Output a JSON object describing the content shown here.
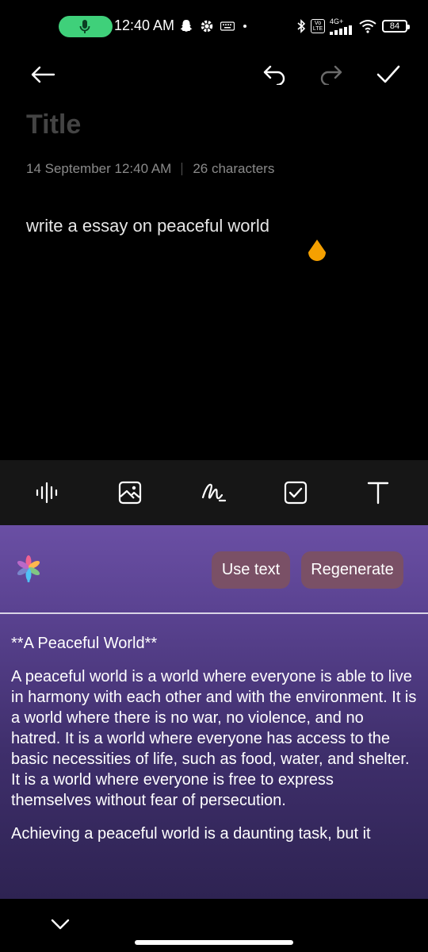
{
  "status_bar": {
    "time": "12:40 AM",
    "battery": "84",
    "network": "4G+",
    "volte": "Vo LTE",
    "icons": [
      "mic-icon",
      "snapchat-icon",
      "settings-icon",
      "keyboard-icon",
      "dot-icon",
      "bluetooth-icon",
      "signal-icon",
      "wifi-icon",
      "battery-icon"
    ]
  },
  "toolbar": {
    "icons": [
      "back-arrow-icon",
      "undo-icon",
      "redo-icon",
      "check-icon"
    ]
  },
  "note": {
    "title_placeholder": "Title",
    "date": "14 September 12:40 AM",
    "char_count": "26 characters",
    "body": "write a essay on peaceful world"
  },
  "format_bar": {
    "icons": [
      "audio-icon",
      "image-icon",
      "handwriting-icon",
      "checklist-icon",
      "text-format-icon"
    ]
  },
  "ai_panel": {
    "use_text_label": "Use text",
    "regenerate_label": "Regenerate",
    "paragraphs": [
      "**A Peaceful World**",
      "A peaceful world is a world where everyone is able to live in harmony with each other and with the environment. It is a world where there is no war, no violence, and no hatred. It is a world where everyone has access to the basic necessities of life, such as food, water, and shelter. It is a world where everyone is free to express themselves without fear of persecution.",
      "Achieving a peaceful world is a daunting task, but it"
    ]
  },
  "colors": {
    "mic_pill": "#3fd07a",
    "accent_handle": "#f5a000",
    "button_bg": "#7a5066",
    "panel_top": "#6a4fa4",
    "panel_bottom": "#2e2352"
  }
}
